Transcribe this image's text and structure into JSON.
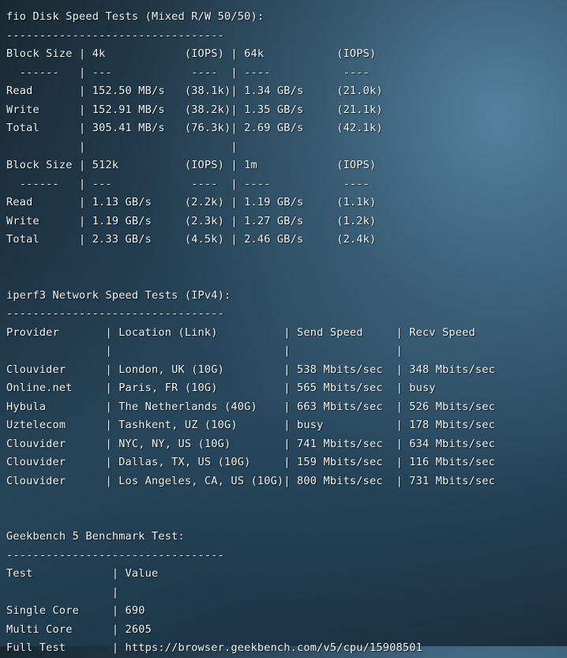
{
  "terminal": {
    "type": "benchmark-output",
    "colors": {
      "text": "#f2f5f7",
      "background_dark": "#17262f",
      "background_light": "#5686a3"
    },
    "lines": [
      "fio Disk Speed Tests (Mixed R/W 50/50):",
      "---------------------------------",
      "Block Size | 4k            (IOPS) | 64k           (IOPS)",
      "  ------   | ---            ----  | ----           ---- ",
      "Read       | 152.50 MB/s   (38.1k) | 1.34 GB/s     (21.0k)",
      "Write      | 152.91 MB/s   (38.2k) | 1.35 GB/s     (21.1k)",
      "Total      | 305.41 MB/s   (76.3k) | 2.69 GB/s     (42.1k)",
      "           |                       |",
      "Block Size | 512k          (IOPS) | 1m            (IOPS)",
      "  ------   | ---            ----  | ----           ---- ",
      "Read       | 1.13 GB/s      (2.2k) | 1.19 GB/s      (1.1k)",
      "Write      | 1.19 GB/s      (2.3k) | 1.27 GB/s      (1.2k)",
      "Total      | 2.33 GB/s      (4.5k) | 2.46 GB/s      (2.4k)",
      "",
      "",
      "iperf3 Network Speed Tests (IPv4):",
      "---------------------------------",
      "Provider       | Location (Link)           | Send Speed    | Recv Speed",
      "               |                           |               |",
      "Clouvider      | London, UK (10G)          | 538 Mbits/sec | 348 Mbits/sec",
      "Online.net     | Paris, FR (10G)           | 565 Mbits/sec | busy",
      "Hybula         | The Netherlands (40G)     | 663 Mbits/sec | 526 Mbits/sec",
      "Uztelecom      | Tashkent, UZ (10G)        | busy          | 178 Mbits/sec",
      "Clouvider      | NYC, NY, US (10G)         | 741 Mbits/sec | 634 Mbits/sec",
      "Clouvider      | Dallas, TX, US (10G)      | 159 Mbits/sec | 116 Mbits/sec",
      "Clouvider      | Los Angeles, CA, US (10G) | 800 Mbits/sec | 731 Mbits/sec",
      "",
      "",
      "Geekbench 5 Benchmark Test:",
      "---------------------------------",
      "Test            | Value",
      "                |",
      "Single Core     | 690",
      "Multi Core      | 2605",
      "Full Test       | https://browser.geekbench.com/v5/cpu/15908501"
    ],
    "sections": {
      "fio": {
        "title": "fio Disk Speed Tests (Mixed R/W 50/50):",
        "separator": "---------------------------------",
        "blocks": [
          {
            "header_label": "Block Size",
            "col1_size": "4k",
            "col1_iops_label": "(IOPS)",
            "col2_size": "64k",
            "col2_iops_label": "(IOPS)",
            "rows": [
              {
                "label": "Read",
                "col1_value": "152.50 MB/s",
                "col1_iops": "(38.1k)",
                "col2_value": "1.34 GB/s",
                "col2_iops": "(21.0k)"
              },
              {
                "label": "Write",
                "col1_value": "152.91 MB/s",
                "col1_iops": "(38.2k)",
                "col2_value": "1.35 GB/s",
                "col2_iops": "(21.1k)"
              },
              {
                "label": "Total",
                "col1_value": "305.41 MB/s",
                "col1_iops": "(76.3k)",
                "col2_value": "2.69 GB/s",
                "col2_iops": "(42.1k)"
              }
            ]
          },
          {
            "header_label": "Block Size",
            "col1_size": "512k",
            "col1_iops_label": "(IOPS)",
            "col2_size": "1m",
            "col2_iops_label": "(IOPS)",
            "rows": [
              {
                "label": "Read",
                "col1_value": "1.13 GB/s",
                "col1_iops": "(2.2k)",
                "col2_value": "1.19 GB/s",
                "col2_iops": "(1.1k)"
              },
              {
                "label": "Write",
                "col1_value": "1.19 GB/s",
                "col1_iops": "(2.3k)",
                "col2_value": "1.27 GB/s",
                "col2_iops": "(1.2k)"
              },
              {
                "label": "Total",
                "col1_value": "2.33 GB/s",
                "col1_iops": "(4.5k)",
                "col2_value": "2.46 GB/s",
                "col2_iops": "(2.4k)"
              }
            ]
          }
        ]
      },
      "iperf3": {
        "title": "iperf3 Network Speed Tests (IPv4):",
        "separator": "---------------------------------",
        "columns": [
          "Provider",
          "Location (Link)",
          "Send Speed",
          "Recv Speed"
        ],
        "rows": [
          {
            "provider": "Clouvider",
            "location": "London, UK (10G)",
            "send": "538 Mbits/sec",
            "recv": "348 Mbits/sec"
          },
          {
            "provider": "Online.net",
            "location": "Paris, FR (10G)",
            "send": "565 Mbits/sec",
            "recv": "busy"
          },
          {
            "provider": "Hybula",
            "location": "The Netherlands (40G)",
            "send": "663 Mbits/sec",
            "recv": "526 Mbits/sec"
          },
          {
            "provider": "Uztelecom",
            "location": "Tashkent, UZ (10G)",
            "send": "busy",
            "recv": "178 Mbits/sec"
          },
          {
            "provider": "Clouvider",
            "location": "NYC, NY, US (10G)",
            "send": "741 Mbits/sec",
            "recv": "634 Mbits/sec"
          },
          {
            "provider": "Clouvider",
            "location": "Dallas, TX, US (10G)",
            "send": "159 Mbits/sec",
            "recv": "116 Mbits/sec"
          },
          {
            "provider": "Clouvider",
            "location": "Los Angeles, CA, US (10G)",
            "send": "800 Mbits/sec",
            "recv": "731 Mbits/sec"
          }
        ]
      },
      "geekbench": {
        "title": "Geekbench 5 Benchmark Test:",
        "separator": "---------------------------------",
        "columns": [
          "Test",
          "Value"
        ],
        "rows": [
          {
            "test": "Single Core",
            "value": "690"
          },
          {
            "test": "Multi Core",
            "value": "2605"
          },
          {
            "test": "Full Test",
            "value": "https://browser.geekbench.com/v5/cpu/15908501"
          }
        ]
      }
    }
  }
}
